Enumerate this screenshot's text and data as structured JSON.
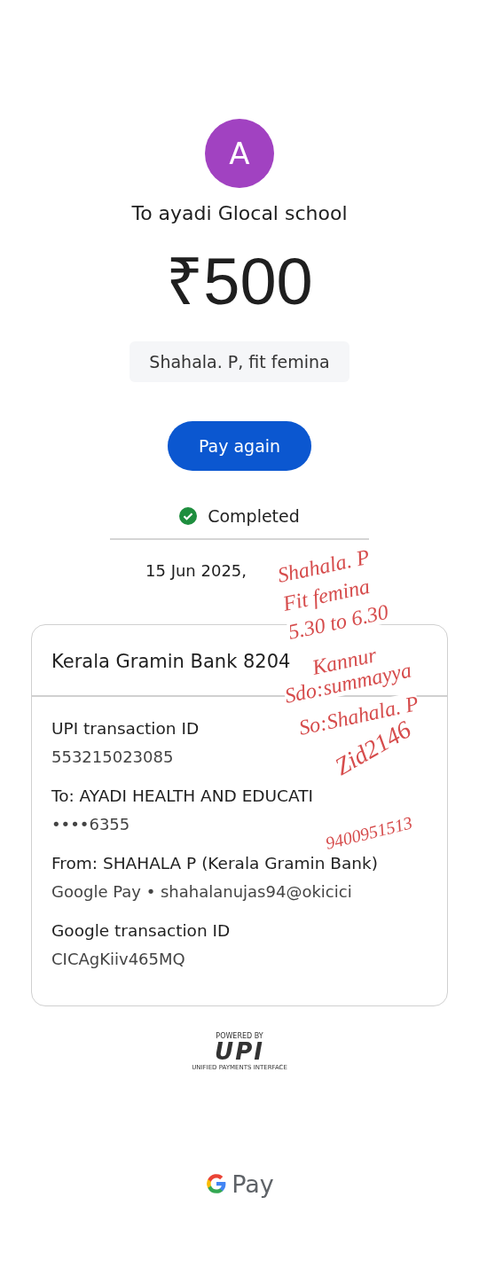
{
  "recipient": {
    "avatar_letter": "A",
    "title": "To ayadi Glocal school"
  },
  "amount": {
    "currency": "₹",
    "value": "500"
  },
  "note": "Shahala. P, fit femina",
  "pay_again_button": "Pay again",
  "status": {
    "label": "Completed",
    "kind": "success"
  },
  "date": "15 Jun 2025,",
  "card": {
    "header": "Kerala Gramin Bank 8204",
    "rows": [
      {
        "label": "UPI transaction ID",
        "value": "553215023085"
      },
      {
        "label": "To: AYADI HEALTH AND EDUCATI",
        "value": "••••6355"
      },
      {
        "label": "From: SHAHALA P (Kerala Gramin Bank)",
        "value": "Google Pay • shahalanujas94@okicici"
      },
      {
        "label": "Google transaction ID",
        "value": "CICAgKiiv465MQ"
      }
    ]
  },
  "upi_logo": {
    "powered_by": "POWERED BY",
    "name": "UPI",
    "tagline": "UNIFIED PAYMENTS INTERFACE"
  },
  "footer_brand": "Pay",
  "handwritten_note": [
    "Shahala. P",
    "Fit femina",
    "5.30 to 6.30",
    "Kannur",
    "Sdo:summayya",
    "So:Shahala. P",
    "Zid2146",
    "9400951513"
  ]
}
